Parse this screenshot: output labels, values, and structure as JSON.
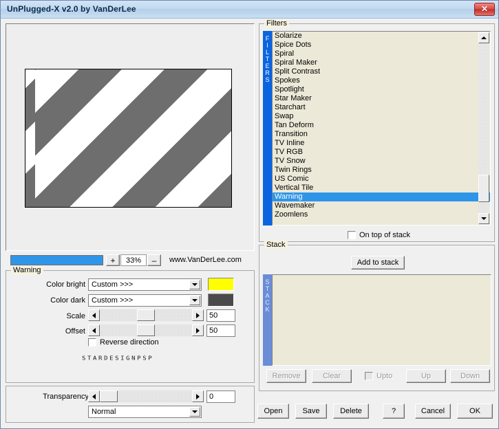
{
  "window": {
    "title": "UnPlugged-X v2.0 by VanDerLee",
    "close_label": "✕"
  },
  "preview": {
    "zoom_percent": "33%",
    "zoom_in_label": "+",
    "zoom_out_label": "–",
    "website": "www.VanDerLee.com",
    "stripe_color_dark": "#6e6e6e",
    "stripe_color_light": "#ffffff",
    "zoom_bar_color": "#2f95e8"
  },
  "params": {
    "group_label": "Warning",
    "color_bright": {
      "label": "Color bright",
      "value": "Custom >>>",
      "swatch": "#ffff00"
    },
    "color_dark": {
      "label": "Color dark",
      "value": "Custom >>>",
      "swatch": "#4a4a4a"
    },
    "scale": {
      "label": "Scale",
      "value": "50"
    },
    "offset": {
      "label": "Offset",
      "value": "50"
    },
    "reverse_direction": {
      "label": "Reverse direction",
      "checked": false
    },
    "logo_text": "STARDESIGNPSP"
  },
  "transparency": {
    "label": "Transparency",
    "value": "0",
    "blend_mode": "Normal"
  },
  "filters": {
    "group_label": "Filters",
    "sidebar_label": "FILTERS",
    "selected": "Warning",
    "items": [
      "Solarize",
      "Spice Dots",
      "Spiral",
      "Spiral Maker",
      "Split Contrast",
      "Spokes",
      "Spotlight",
      "Star Maker",
      "Starchart",
      "Swap",
      "Tan Deform",
      "Transition",
      "TV Inline",
      "TV RGB",
      "TV Snow",
      "Twin Rings",
      "US Comic",
      "Vertical Tile",
      "Warning",
      "Wavemaker",
      "Zoomlens"
    ],
    "on_top_of_stack": {
      "label": "On top of stack",
      "checked": false
    }
  },
  "stack": {
    "group_label": "Stack",
    "sidebar_label": "STACK",
    "add_label": "Add to stack",
    "items": [],
    "buttons": [
      {
        "label": "Remove",
        "disabled": true
      },
      {
        "label": "Clear",
        "disabled": true
      },
      {
        "label": "Up",
        "disabled": true
      },
      {
        "label": "Down",
        "disabled": true
      }
    ],
    "upto": {
      "label": "Upto",
      "checked": false,
      "disabled": true
    }
  },
  "bottom_buttons": [
    {
      "label": "Open"
    },
    {
      "label": "Save"
    },
    {
      "label": "Delete"
    },
    {
      "label": "?"
    },
    {
      "label": "Cancel"
    },
    {
      "label": "OK"
    }
  ]
}
